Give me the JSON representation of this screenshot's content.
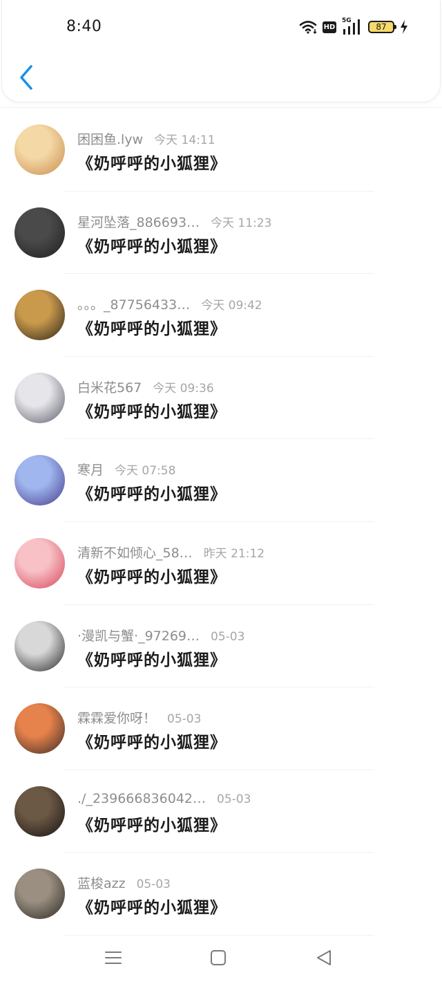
{
  "status_bar": {
    "time": "8:40",
    "network": "5G",
    "hd": "HD",
    "battery": "87"
  },
  "comments": [
    {
      "name": "困困鱼.lyw",
      "time": "今天 14:11",
      "message": "《奶呼呼的小狐狸》",
      "avatar_colors": [
        "#f4d9a6",
        "#c98a4b"
      ]
    },
    {
      "name": "星河坠落_886693…",
      "time": "今天 11:23",
      "message": "《奶呼呼的小狐狸》",
      "avatar_colors": [
        "#4a4a4a",
        "#1e1e1e"
      ]
    },
    {
      "name": "。。。_87756433…",
      "time": "今天 09:42",
      "message": "《奶呼呼的小狐狸》",
      "avatar_colors": [
        "#c99a4c",
        "#2a2218"
      ]
    },
    {
      "name": "白米花567",
      "time": "今天 09:36",
      "message": "《奶呼呼的小狐狸》",
      "avatar_colors": [
        "#e5e5ea",
        "#5b5b66"
      ]
    },
    {
      "name": "寒月",
      "time": "今天 07:58",
      "message": "《奶呼呼的小狐狸》",
      "avatar_colors": [
        "#9fb6ef",
        "#463a8a"
      ]
    },
    {
      "name": "清新不如倾心_58…",
      "time": "昨天 21:12",
      "message": "《奶呼呼的小狐狸》",
      "avatar_colors": [
        "#f7c1c6",
        "#d9435a"
      ]
    },
    {
      "name": "·漫凯与蟹·_97269…",
      "time": "05-03",
      "message": "《奶呼呼的小狐狸》",
      "avatar_colors": [
        "#d8d8d8",
        "#262626"
      ]
    },
    {
      "name": "霖霖爱你呀！",
      "time": "05-03",
      "message": "《奶呼呼的小狐狸》",
      "avatar_colors": [
        "#e6824b",
        "#3a2a24"
      ]
    },
    {
      "name": "./_239666836042…",
      "time": "05-03",
      "message": "《奶呼呼的小狐狸》",
      "avatar_colors": [
        "#6b5845",
        "#151210"
      ]
    },
    {
      "name": "蓝梭azz",
      "time": "05-03",
      "message": "《奶呼呼的小狐狸》",
      "avatar_colors": [
        "#9a8f80",
        "#2b2622"
      ]
    }
  ],
  "colors": {
    "accent": "#1a8fe8",
    "name_text": "#8d8d8d",
    "message_text": "#1c1c1c"
  },
  "icons": {
    "back": "chevron-left-icon",
    "menu": "menu-icon",
    "home": "home-square-icon",
    "nav_back": "triangle-back-icon"
  }
}
